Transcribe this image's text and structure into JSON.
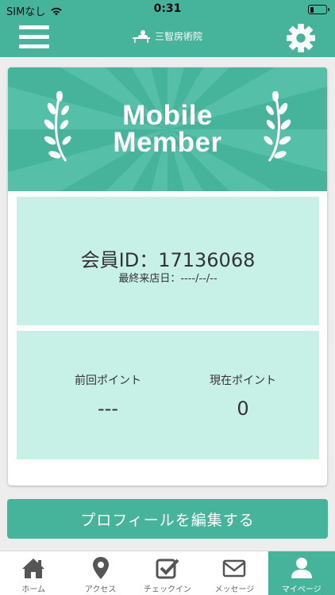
{
  "status_bar": {
    "carrier": "SIMなし",
    "time": "0:31",
    "battery_level": 0.2
  },
  "header": {
    "logo_text": "三智房術院"
  },
  "banner": {
    "title_line1": "Mobile",
    "title_line2": "Member"
  },
  "member": {
    "id_label": "会員ID：17136068",
    "last_visit_label": "最終来店日：----/--/--"
  },
  "points": {
    "previous_label": "前回ポイント",
    "previous_value": "---",
    "current_label": "現在ポイント",
    "current_value": "0"
  },
  "actions": {
    "edit_profile": "プロフィールを編集する"
  },
  "tabs": [
    {
      "label": "ホーム",
      "icon": "home-icon"
    },
    {
      "label": "アクセス",
      "icon": "map-pin-icon"
    },
    {
      "label": "チェックイン",
      "icon": "checkbox-icon"
    },
    {
      "label": "メッセージ",
      "icon": "envelope-icon"
    },
    {
      "label": "マイページ",
      "icon": "user-icon",
      "active": true
    }
  ],
  "colors": {
    "accent": "#45b49b",
    "panel": "#c7f0e7",
    "banner_light": "#62c7b0"
  }
}
